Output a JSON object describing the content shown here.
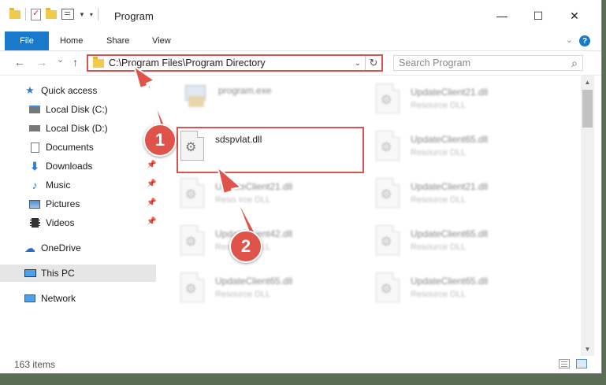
{
  "window": {
    "title": "Program",
    "minimize_glyph": "—",
    "maximize_glyph": "☐",
    "close_glyph": "✕"
  },
  "ribbon": {
    "file": "File",
    "home": "Home",
    "share": "Share",
    "view": "View",
    "help_glyph": "?"
  },
  "nav": {
    "back_glyph": "←",
    "forward_glyph": "→",
    "recent_glyph": "⌄",
    "up_glyph": "↑",
    "address": "C:\\Program Files\\Program Directory",
    "refresh_glyph": "↻",
    "search_placeholder": "Search Program",
    "search_glyph": "⌕"
  },
  "sidebar": {
    "items": [
      {
        "label": "Quick access",
        "icon": "star-icon"
      },
      {
        "label": "Local Disk (C:)",
        "icon": "drive-icon"
      },
      {
        "label": "Local Disk (D:)",
        "icon": "drive-icon"
      },
      {
        "label": "Documents",
        "icon": "documents-icon"
      },
      {
        "label": "Downloads",
        "icon": "download-icon"
      },
      {
        "label": "Music",
        "icon": "music-icon"
      },
      {
        "label": "Pictures",
        "icon": "pictures-icon"
      },
      {
        "label": "Videos",
        "icon": "videos-icon"
      },
      {
        "label": "OneDrive",
        "icon": "cloud-icon"
      },
      {
        "label": "This PC",
        "icon": "computer-icon"
      },
      {
        "label": "Network",
        "icon": "network-icon"
      }
    ]
  },
  "files": {
    "program_exe": {
      "name": "program.exe"
    },
    "sdspvlat": {
      "name": "sdspvlat.dll"
    },
    "left_col": [
      {
        "name": "UpdateClient21.dll",
        "type": "Resource DLL"
      },
      {
        "name": "UpdateClient42.dll",
        "type": "Resource DLL"
      },
      {
        "name": "UpdateClient65.dll",
        "type": "Resource DLL"
      }
    ],
    "right_col": [
      {
        "name": "UpdateClient21.dll",
        "type": "Resource DLL"
      },
      {
        "name": "UpdateClient65.dll",
        "type": "Resource DLL"
      },
      {
        "name": "UpdateClient21.dll",
        "type": "Resource DLL"
      },
      {
        "name": "UpdateClient65.dll",
        "type": "Resource DLL"
      },
      {
        "name": "UpdateClient65.dll",
        "type": "Resource DLL"
      }
    ]
  },
  "status": {
    "count": "163 items"
  },
  "annotations": {
    "marker_1": "1",
    "marker_2": "2",
    "color": "#e0534a"
  },
  "colors": {
    "accent": "#1979ca",
    "highlight_border": "#d9534f"
  }
}
